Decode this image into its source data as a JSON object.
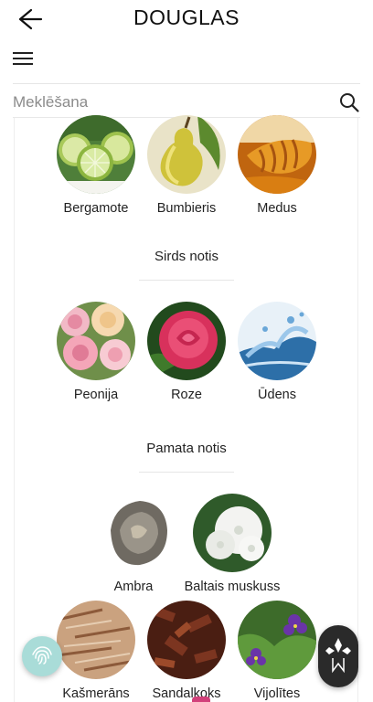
{
  "header": {
    "brand": "DOUGLAS",
    "back_icon": "arrow-left-icon",
    "menu_icon": "hamburger-icon"
  },
  "search": {
    "placeholder": "Meklēšana",
    "value": "",
    "icon": "search-icon"
  },
  "top_notes": {
    "items": [
      {
        "label": "Bergamote",
        "image": "lime-slices"
      },
      {
        "label": "Bumbieris",
        "image": "pear"
      },
      {
        "label": "Medus",
        "image": "honey-dipper"
      }
    ]
  },
  "heart_notes": {
    "title": "Sirds notis",
    "items": [
      {
        "label": "Peonija",
        "image": "peonies"
      },
      {
        "label": "Roze",
        "image": "red-rose"
      },
      {
        "label": "Ūdens",
        "image": "water-splash"
      }
    ]
  },
  "base_notes": {
    "title": "Pamata notis",
    "items": [
      {
        "label": "Ambra",
        "image": "ambergris-stone"
      },
      {
        "label": "Baltais muskuss",
        "image": "white-flowers"
      },
      {
        "label": "Kašmerāns",
        "image": "wood-shavings"
      },
      {
        "label": "Sandalkoks",
        "image": "sandalwood-chips"
      },
      {
        "label": "Vijolītes",
        "image": "violets"
      }
    ]
  },
  "colors": {
    "fab_fingerprint": "#a9dcd8",
    "fab_brand": "#2a2a2a",
    "accent": "#d2407a"
  }
}
